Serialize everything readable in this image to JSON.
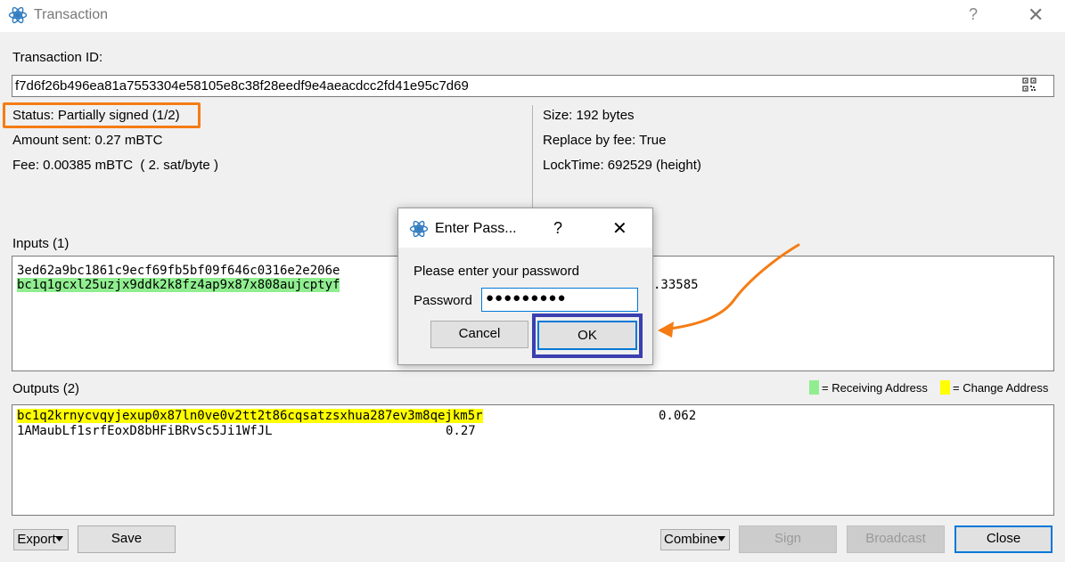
{
  "window": {
    "title": "Transaction",
    "help_glyph": "?",
    "close_glyph": "✕"
  },
  "transaction": {
    "id_label": "Transaction ID:",
    "id_value": "f7d6f26b496ea81a7553304e58105e8c38f28eedf9e4aeacdcc2fd41e95c7d69",
    "status": "Status: Partially signed (1/2)",
    "amount_sent": "Amount sent: 0.27 mBTC",
    "fee": "Fee: 0.00385 mBTC  ( 2. sat/byte )",
    "size": "Size: 192 bytes",
    "replace_by_fee": "Replace by fee: True",
    "locktime": "LockTime: 692529 (height)"
  },
  "inputs": {
    "label": "Inputs (1)",
    "rows": [
      {
        "text": "3ed62a9bc1861c9ecf69fb5bf09f646c0316e2e206e",
        "highlight": "none"
      },
      {
        "text": "bc1q1gcxl25uzjx9ddk2k8fz4ap9x87x808aujcptyf",
        "highlight": "receiving"
      }
    ],
    "amount_fragment": ".33585"
  },
  "outputs": {
    "label": "Outputs (2)",
    "rows": [
      {
        "address": "bc1q2krnycvqyjexup0x87ln0ve0v2tt2t86cqsatzsxhua287ev3m8qejkm5r",
        "amount": "0.062",
        "highlight": "change"
      },
      {
        "address": "1AMaubLf1srfEoxD8bHFiBRvSc5Ji1WfJL",
        "amount": "0.27",
        "highlight": "none"
      }
    ]
  },
  "legend": {
    "receiving_label": "= Receiving Address",
    "change_label": "= Change Address",
    "receiving_color": "#90ee90",
    "change_color": "#ffff00"
  },
  "buttons": {
    "export": "Export",
    "save": "Save",
    "combine": "Combine",
    "sign": "Sign",
    "broadcast": "Broadcast",
    "close": "Close"
  },
  "dialog": {
    "title": "Enter Pass...",
    "help_glyph": "?",
    "close_glyph": "✕",
    "prompt": "Please enter your password",
    "password_label": "Password",
    "password_value": "●●●●●●●●●",
    "cancel": "Cancel",
    "ok": "OK"
  },
  "annotations": {
    "status_outline_color": "#f57c14",
    "ok_outline_color": "#3b3fb0",
    "arrow_color": "#f57c14"
  },
  "icons": {
    "app": "electrum-logo-icon",
    "qr": "qr-code-icon",
    "dropdown": "chevron-down-icon"
  }
}
